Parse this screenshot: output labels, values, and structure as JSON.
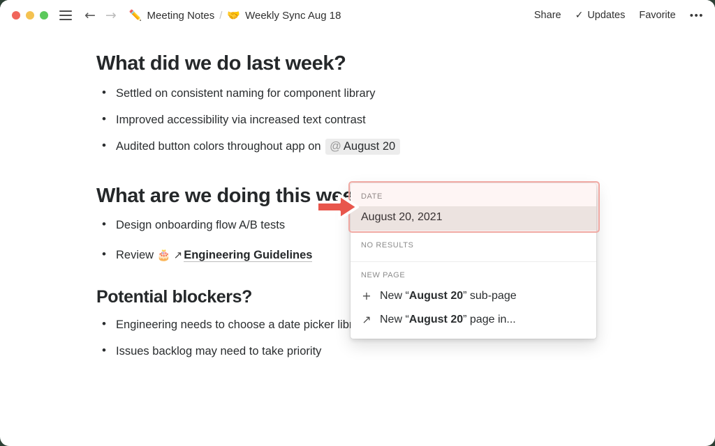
{
  "window": {
    "traffic_lights": [
      "close",
      "minimize",
      "zoom"
    ],
    "backdrop_color": "#2d4035"
  },
  "titlebar": {
    "menu_icon": "hamburger-icon",
    "back_label": "←",
    "forward_label": "→",
    "breadcrumb": [
      {
        "emoji": "✏️",
        "label": "Meeting Notes"
      },
      {
        "emoji": "🤝",
        "label": "Weekly Sync Aug 18"
      }
    ],
    "separator": "/",
    "actions": {
      "share": "Share",
      "updates": "Updates",
      "updates_check": "✓",
      "favorite": "Favorite",
      "more": "•••"
    }
  },
  "document": {
    "sections": [
      {
        "heading": "What did we do last week?",
        "bullets": [
          {
            "text": "Settled on consistent naming for component library"
          },
          {
            "text": "Improved accessibility via increased text contrast"
          },
          {
            "text": "Audited button colors throughout app on ",
            "mention": {
              "at": "@",
              "label": "August 20"
            }
          }
        ]
      },
      {
        "heading": "What are we doing this week?",
        "bullets": [
          {
            "text": "Design onboarding flow A/B tests"
          },
          {
            "text": "Review ",
            "emoji": "🎂",
            "arrow": "↗",
            "link": "Engineering Guidelines"
          }
        ]
      },
      {
        "heading": "Potential blockers?",
        "bullets": [
          {
            "text": "Engineering needs to choose a date picker library and communicate limitations"
          },
          {
            "text": "Issues backlog may need to take priority"
          }
        ]
      }
    ]
  },
  "popup": {
    "date_section": {
      "label": "DATE",
      "item": "August 20, 2021"
    },
    "no_results_label": "NO RESULTS",
    "new_page_section": {
      "label": "NEW PAGE",
      "items": [
        {
          "icon": "+",
          "prefix": "New “",
          "bold": "August 20",
          "suffix": "” sub-page"
        },
        {
          "icon": "↗",
          "prefix": "New “",
          "bold": "August 20",
          "suffix": "” page in..."
        }
      ]
    }
  },
  "annotation": {
    "highlight_color": "#f0a9a3",
    "arrow_color": "#e8564c",
    "arrow_direction": "right"
  }
}
